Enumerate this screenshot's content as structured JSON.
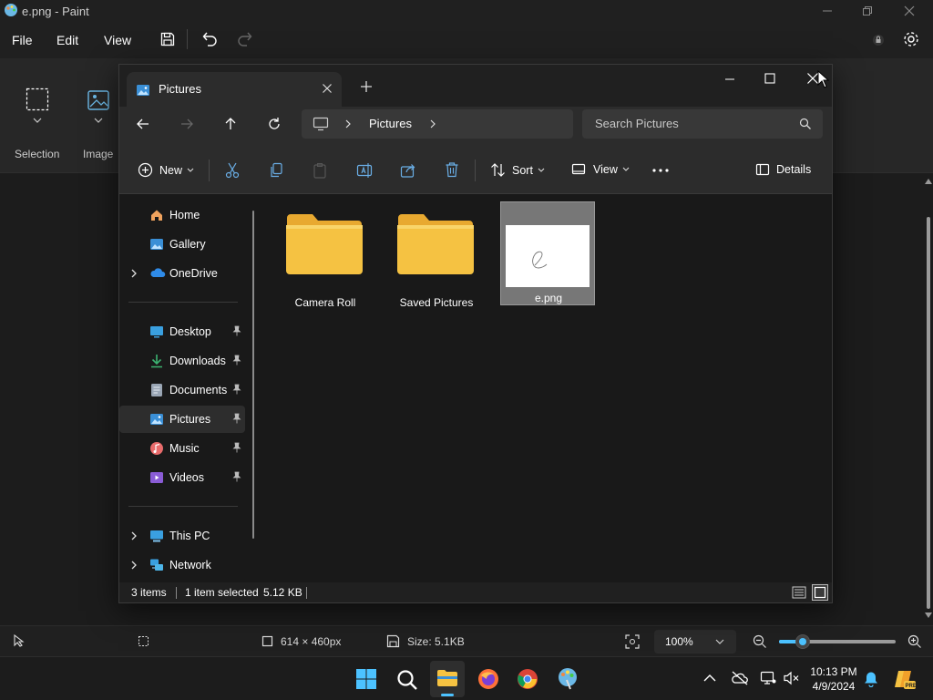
{
  "paint": {
    "title": "e.png - Paint",
    "menu": [
      "File",
      "Edit",
      "View"
    ],
    "ribbon": {
      "selection_label": "Selection",
      "image_label": "Image"
    },
    "status": {
      "dimensions": "614 × 460px",
      "size": "Size: 5.1KB",
      "zoom": "100%",
      "zoom_slider_fraction": 0.2
    }
  },
  "explorer": {
    "tab_title": "Pictures",
    "breadcrumb": [
      "Pictures"
    ],
    "search_placeholder": "Search Pictures",
    "toolbar": {
      "new_label": "New",
      "sort_label": "Sort",
      "view_label": "View",
      "details_label": "Details"
    },
    "nav": {
      "group1": [
        {
          "label": "Home",
          "icon": "home-icon"
        },
        {
          "label": "Gallery",
          "icon": "gallery-icon"
        },
        {
          "label": "OneDrive",
          "icon": "cloud-icon",
          "expandable": true
        }
      ],
      "pinned": [
        {
          "label": "Desktop",
          "icon": "desktop-icon"
        },
        {
          "label": "Downloads",
          "icon": "download-icon"
        },
        {
          "label": "Documents",
          "icon": "documents-icon"
        },
        {
          "label": "Pictures",
          "icon": "pictures-icon",
          "selected": true
        },
        {
          "label": "Music",
          "icon": "music-icon"
        },
        {
          "label": "Videos",
          "icon": "videos-icon"
        }
      ],
      "group3": [
        {
          "label": "This PC",
          "icon": "pc-icon"
        },
        {
          "label": "Network",
          "icon": "network-icon"
        }
      ]
    },
    "files": [
      {
        "name": "Camera Roll",
        "type": "folder"
      },
      {
        "name": "Saved Pictures",
        "type": "folder"
      },
      {
        "name": "e.png",
        "type": "image",
        "selected": true
      }
    ],
    "status": {
      "items": "3 items",
      "selected": "1 item selected",
      "size": "5.12 KB"
    }
  },
  "taskbar": {
    "time": "10:13 PM",
    "date": "4/9/2024",
    "apps": [
      "windows-start-icon",
      "search-icon",
      "file-explorer-icon",
      "firefox-icon",
      "chrome-icon",
      "paint-icon"
    ]
  },
  "colors": {
    "folder": "#f5c242",
    "accent": "#4cc2ff",
    "onedrive": "#2f8be8"
  }
}
